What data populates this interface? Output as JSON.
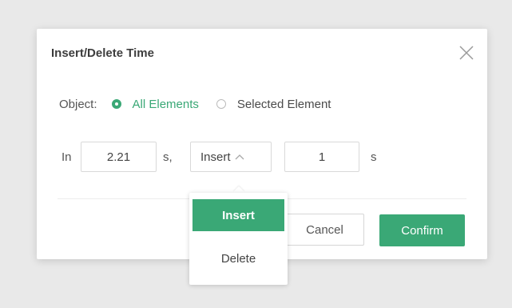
{
  "dialog": {
    "title": "Insert/Delete Time",
    "close_icon": "close-icon"
  },
  "object": {
    "label": "Object:",
    "options": [
      {
        "label": "All Elements",
        "selected": true
      },
      {
        "label": "Selected Element",
        "selected": false
      }
    ]
  },
  "time_row": {
    "prefix": "In",
    "position_value": "2.21",
    "position_unit": "s,",
    "mode_value": "Insert",
    "mode_icon": "chevron-up-icon",
    "amount_value": "1",
    "amount_unit": "s"
  },
  "dropdown": {
    "options": [
      "Insert",
      "Delete"
    ],
    "selected": "Insert"
  },
  "buttons": {
    "cancel": "Cancel",
    "confirm": "Confirm"
  },
  "colors": {
    "accent": "#3aa876",
    "backdrop": "#e9e9e9"
  }
}
